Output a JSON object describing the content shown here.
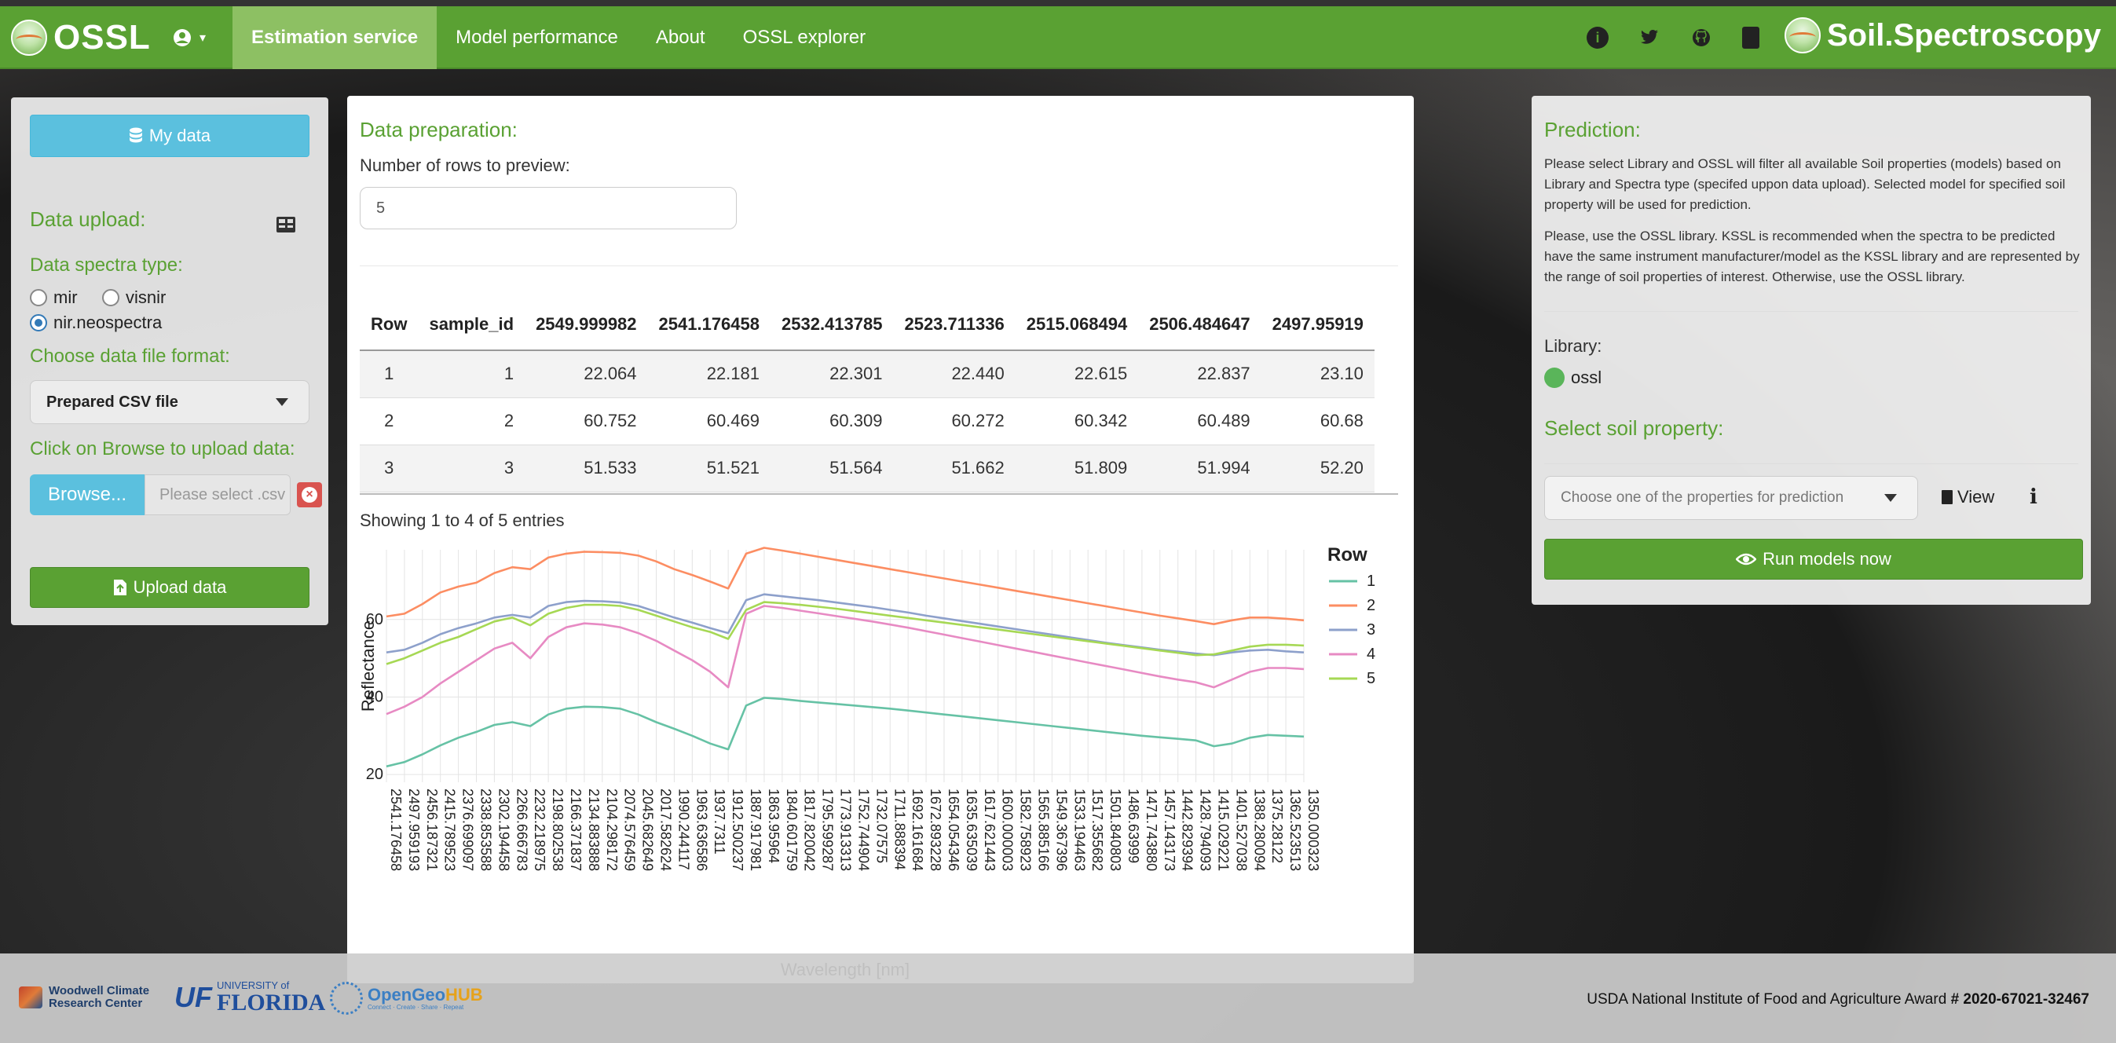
{
  "navbar": {
    "brand": "OSSL",
    "user_caret": "▾",
    "tabs": [
      {
        "label": "Estimation service",
        "active": true
      },
      {
        "label": "Model performance",
        "active": false
      },
      {
        "label": "About",
        "active": false
      },
      {
        "label": "OSSL explorer",
        "active": false
      }
    ],
    "right_brand": "Soil.Spectroscopy",
    "icons": [
      "info-icon",
      "twitter-icon",
      "github-icon",
      "book-icon"
    ]
  },
  "sidebar": {
    "my_data_label": "My data",
    "data_upload_title": "Data upload:",
    "spectra_type_label": "Data spectra type:",
    "spectra_options": [
      {
        "label": "mir",
        "checked": false
      },
      {
        "label": "visnir",
        "checked": false
      },
      {
        "label": "nir.neospectra",
        "checked": true
      }
    ],
    "file_format_label": "Choose data file format:",
    "file_format_value": "Prepared CSV file",
    "browse_label": "Click on Browse to upload data:",
    "browse_button": "Browse...",
    "file_placeholder": "Please select .csv",
    "clear_glyph": "×",
    "upload_button": "Upload data"
  },
  "main": {
    "title": "Data preparation:",
    "rows_label": "Number of rows to preview:",
    "rows_value": "5",
    "columns": [
      "Row",
      "sample_id",
      "2549.999982",
      "2541.176458",
      "2532.413785",
      "2523.711336",
      "2515.068494",
      "2506.484647",
      "2497.95919"
    ],
    "rows": [
      [
        "1",
        "1",
        "22.064",
        "22.181",
        "22.301",
        "22.440",
        "22.615",
        "22.837",
        "23.10"
      ],
      [
        "2",
        "2",
        "60.752",
        "60.469",
        "60.309",
        "60.272",
        "60.342",
        "60.489",
        "60.68"
      ],
      [
        "3",
        "3",
        "51.533",
        "51.521",
        "51.564",
        "51.662",
        "51.809",
        "51.994",
        "52.20"
      ]
    ],
    "showing_text": "Showing 1 to 4 of 5 entries"
  },
  "chart_data": {
    "type": "line",
    "xlabel": "Wavelength [nm]",
    "ylabel": "Reflectance",
    "legend_title": "Row",
    "legend_position": "right",
    "grid": true,
    "y_ticks": [
      20,
      40,
      60
    ],
    "ylim": [
      18,
      78
    ],
    "x_ticks": [
      "2541.176458",
      "2497.959193",
      "2456.187321",
      "2415.789523",
      "2376.699097",
      "2338.853588",
      "2302.194458",
      "2266.666783",
      "2232.218975",
      "2198.802538",
      "2166.371837",
      "2134.883888",
      "2104.298172",
      "2074.576459",
      "2045.682649",
      "2017.582624",
      "1990.244117",
      "1963.636586",
      "1937.7311",
      "1912.500237",
      "1887.917981",
      "1863.95964",
      "1840.601759",
      "1817.820042",
      "1795.599287",
      "1773.913313",
      "1752.744904",
      "1732.07575",
      "1711.888394",
      "1692.161684",
      "1672.893228",
      "1654.054346",
      "1635.635039",
      "1617.621443",
      "1600.000003",
      "1582.758923",
      "1565.885166",
      "1549.367396",
      "1533.194463",
      "1517.355682",
      "1501.840803",
      "1486.63999",
      "1471.743880",
      "1457.143173",
      "1442.829394",
      "1428.794093",
      "1415.029221",
      "1401.527038",
      "1388.280094",
      "1375.28122",
      "1362.523513",
      "1350.000323"
    ],
    "series": [
      {
        "name": "1",
        "color": "#66c2a5",
        "values": [
          22.1,
          23.2,
          25.2,
          27.5,
          29.5,
          31.0,
          32.8,
          33.5,
          32.5,
          35.5,
          37.0,
          37.5,
          37.4,
          37.0,
          35.5,
          33.5,
          31.8,
          30.0,
          28.0,
          26.5,
          37.8,
          39.8,
          39.5,
          39.0,
          38.6,
          38.2,
          37.8,
          37.4,
          37.0,
          36.5,
          36.0,
          35.5,
          35.0,
          34.5,
          34.0,
          33.5,
          33.0,
          32.5,
          32.0,
          31.5,
          31.0,
          30.5,
          30.0,
          29.6,
          29.2,
          28.8,
          27.3,
          28.0,
          29.5,
          30.2,
          30.0,
          29.8
        ]
      },
      {
        "name": "2",
        "color": "#fc8d62",
        "values": [
          60.8,
          61.5,
          64.0,
          67.0,
          68.5,
          69.5,
          72.0,
          73.5,
          73.0,
          76.0,
          77.0,
          77.5,
          77.4,
          77.2,
          76.5,
          75.0,
          73.0,
          71.5,
          69.8,
          68.0,
          77.0,
          78.5,
          77.8,
          77.0,
          76.2,
          75.4,
          74.6,
          73.8,
          73.0,
          72.2,
          71.4,
          70.6,
          69.8,
          69.0,
          68.2,
          67.4,
          66.6,
          65.8,
          65.0,
          64.2,
          63.4,
          62.6,
          61.8,
          61.0,
          60.3,
          59.6,
          58.8,
          59.8,
          60.5,
          60.5,
          60.2,
          59.8
        ]
      },
      {
        "name": "3",
        "color": "#8da0cb",
        "values": [
          51.5,
          52.2,
          54.0,
          56.2,
          57.8,
          59.0,
          60.5,
          61.2,
          60.5,
          63.5,
          64.5,
          64.8,
          64.7,
          64.4,
          63.5,
          62.0,
          60.5,
          59.2,
          57.8,
          56.5,
          65.0,
          66.5,
          66.0,
          65.5,
          65.0,
          64.4,
          63.8,
          63.2,
          62.5,
          61.8,
          61.0,
          60.3,
          59.6,
          58.9,
          58.2,
          57.5,
          56.8,
          56.1,
          55.4,
          54.7,
          54.0,
          53.4,
          52.8,
          52.2,
          51.7,
          51.2,
          50.8,
          51.5,
          52.0,
          52.2,
          51.8,
          51.5
        ]
      },
      {
        "name": "4",
        "color": "#e78ac3",
        "values": [
          35.6,
          37.5,
          40.0,
          43.5,
          46.5,
          49.5,
          52.5,
          54.0,
          50.0,
          55.5,
          58.0,
          59.0,
          58.7,
          58.0,
          56.5,
          54.5,
          52.0,
          49.5,
          46.5,
          42.5,
          61.5,
          63.5,
          63.0,
          62.3,
          61.6,
          60.9,
          60.2,
          59.5,
          58.7,
          57.9,
          57.0,
          56.1,
          55.2,
          54.3,
          53.4,
          52.5,
          51.6,
          50.7,
          49.8,
          48.9,
          48.0,
          47.1,
          46.2,
          45.3,
          44.5,
          43.8,
          42.5,
          44.5,
          46.5,
          47.5,
          47.5,
          47.2
        ]
      },
      {
        "name": "5",
        "color": "#a6d854",
        "values": [
          48.5,
          50.0,
          52.0,
          54.0,
          55.5,
          57.5,
          59.5,
          60.5,
          58.5,
          61.5,
          63.0,
          63.8,
          63.8,
          63.5,
          62.5,
          61.0,
          59.5,
          58.0,
          56.8,
          55.0,
          62.5,
          64.5,
          64.2,
          63.8,
          63.3,
          62.8,
          62.2,
          61.6,
          61.0,
          60.4,
          59.8,
          59.2,
          58.6,
          58.0,
          57.4,
          56.8,
          56.2,
          55.6,
          55.0,
          54.4,
          53.8,
          53.2,
          52.6,
          52.0,
          51.4,
          50.8,
          51.0,
          52.0,
          53.0,
          53.5,
          53.5,
          53.3
        ]
      }
    ]
  },
  "prediction": {
    "title": "Prediction:",
    "p1": "Please select Library and OSSL will filter all available Soil properties (models) based on Library and Spectra type (specifed uppon data upload). Selected model for specified soil property will be used for prediction.",
    "p2": "Please, use the OSSL library. KSSL is recommended when the spectra to be predicted have the same instrument manufacturer/model as the KSSL library and are represented by the range of soil properties of interest. Otherwise, use the OSSL library.",
    "library_label": "Library:",
    "library_value": "ossl",
    "soil_title": "Select soil property:",
    "property_placeholder": "Choose one of the properties for prediction",
    "view_label": "View",
    "info_glyph": "i",
    "run_button": "Run models now"
  },
  "footer": {
    "woodwell_line1": "Woodwell Climate",
    "woodwell_line2": "Research Center",
    "uf": "UF",
    "uf_small": "UNIVERSITY of",
    "uf_florida": "FLORIDA",
    "oghub_a": "OpenGeo",
    "oghub_b": "HUB",
    "oghub_sub": "Connect · Create · Share · Repeat",
    "award_text": "USDA National Institute of Food and Agriculture Award ",
    "award_num": "# 2020-67021-32467"
  }
}
